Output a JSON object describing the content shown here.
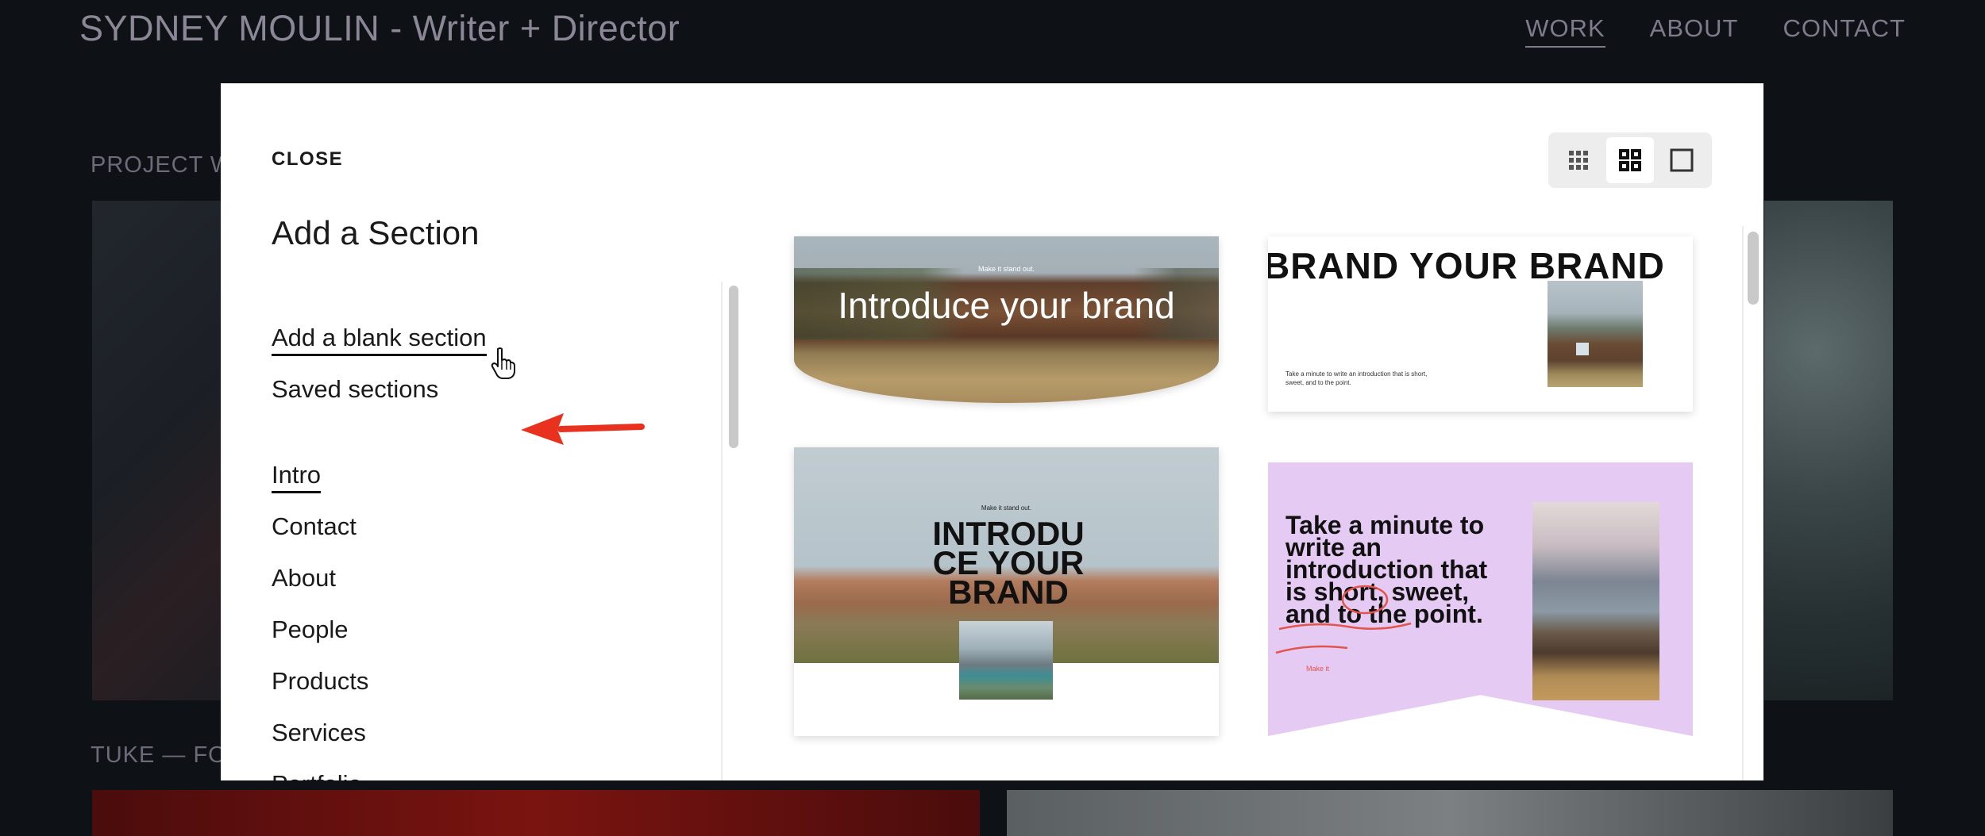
{
  "site": {
    "title": "SYDNEY MOULIN - Writer + Director",
    "nav": [
      {
        "label": "WORK",
        "active": true
      },
      {
        "label": "ABOUT",
        "active": false
      },
      {
        "label": "CONTACT",
        "active": false
      }
    ],
    "labels": {
      "project": "PROJECT W",
      "tuke": "TUKE — FOF"
    }
  },
  "modal": {
    "close_label": "CLOSE",
    "title": "Add a Section",
    "menu": {
      "blank": "Add a blank section",
      "saved": "Saved sections",
      "intro": "Intro",
      "contact": "Contact",
      "about": "About",
      "people": "People",
      "products": "Products",
      "services": "Services",
      "portfolio": "Portfolio"
    },
    "view_options": [
      {
        "icon": "grid-small-icon",
        "active": false
      },
      {
        "icon": "grid-large-icon",
        "active": true
      },
      {
        "icon": "single-view-icon",
        "active": false
      }
    ],
    "cards": {
      "card1": {
        "tag": "Make it stand out.",
        "headline": "Introduce your brand"
      },
      "card2": {
        "headline": "BRAND  YOUR BRAND",
        "body": "Take a minute to write an introduction that is short, sweet, and to the point."
      },
      "card3": {
        "tag": "Make it stand out.",
        "headline": "INTRODUCE YOUR BRAND"
      },
      "card4": {
        "headline": "Take a minute to write an introduction that is short, sweet, and to the point.",
        "small": "Make it"
      }
    }
  },
  "colors": {
    "background": "#0e1116",
    "modal": "#ffffff",
    "arrow": "#e8321f",
    "card4_bg": "#e5cbf3"
  }
}
